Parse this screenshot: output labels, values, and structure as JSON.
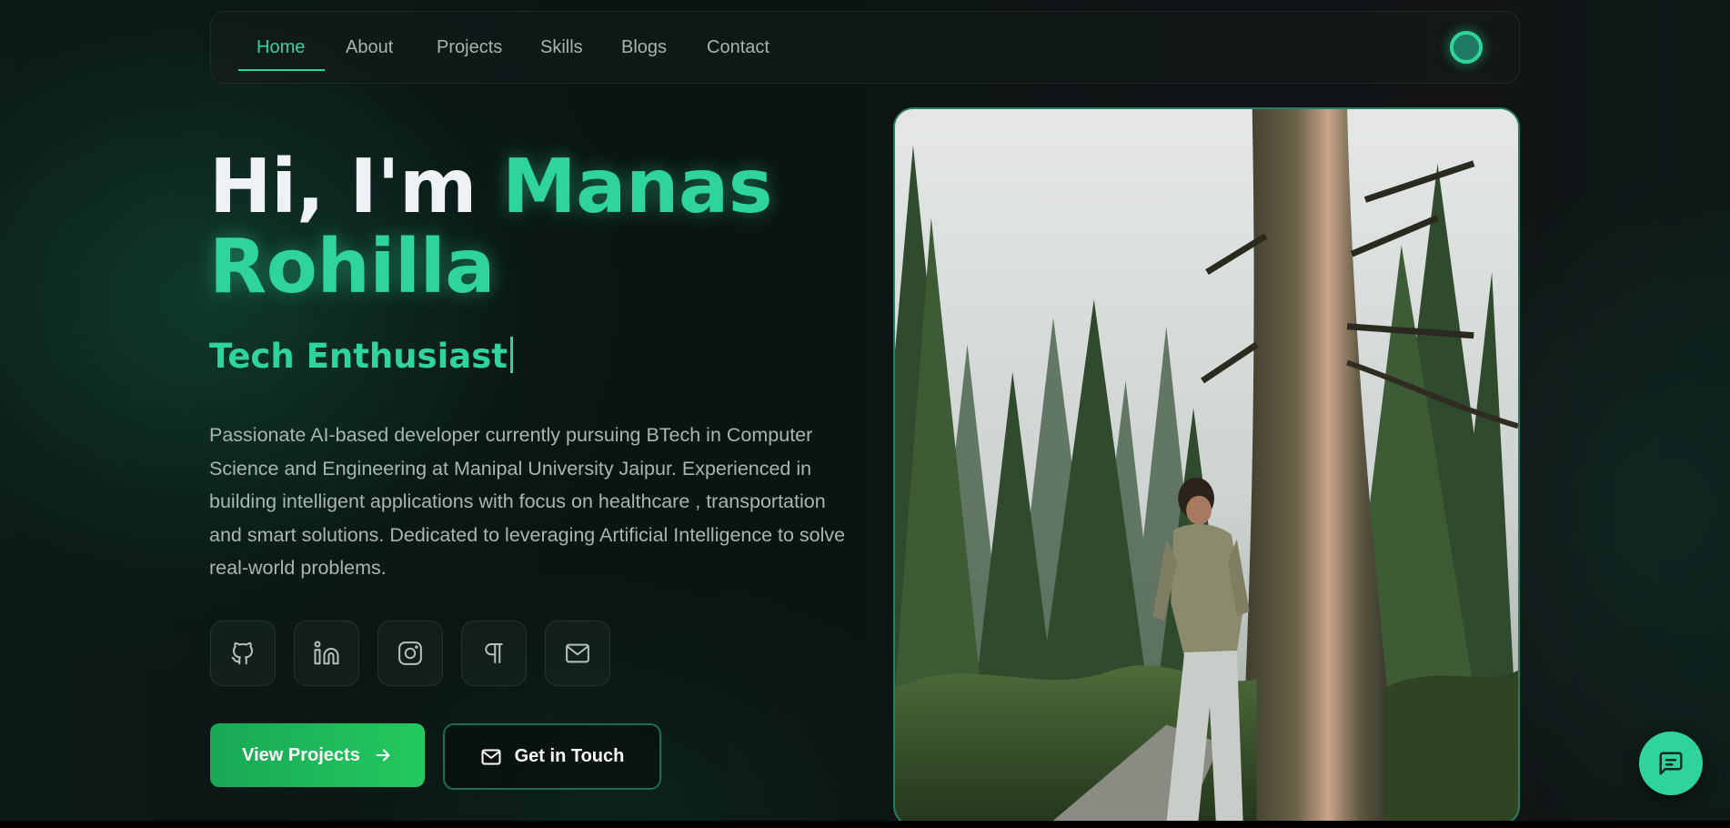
{
  "nav": {
    "items": [
      {
        "label": "Home",
        "active": true
      },
      {
        "label": "About"
      },
      {
        "label": "Projects"
      },
      {
        "label": "Skills"
      },
      {
        "label": "Blogs"
      },
      {
        "label": "Contact"
      }
    ]
  },
  "hero": {
    "greeting": "Hi, I'm",
    "name_first": "Manas",
    "name_last": "Rohilla",
    "subtitle": "Tech Enthusiast",
    "bio": "Passionate AI-based developer currently pursuing BTech in Computer Science and Engineering at Manipal University Jaipur. Experienced in building intelligent applications with focus on healthcare , transportation and smart solutions. Dedicated to leveraging Artificial Intelligence to solve real-world problems."
  },
  "socials": [
    {
      "icon": "github-icon"
    },
    {
      "icon": "linkedin-icon"
    },
    {
      "icon": "instagram-icon"
    },
    {
      "icon": "pilcrow-icon"
    },
    {
      "icon": "mail-icon"
    }
  ],
  "buttons": {
    "primary": "View Projects",
    "secondary": "Get in Touch"
  },
  "colors": {
    "accent": "#2fd39c",
    "primary_button": "#1fb85a",
    "background": "#0b1211"
  }
}
